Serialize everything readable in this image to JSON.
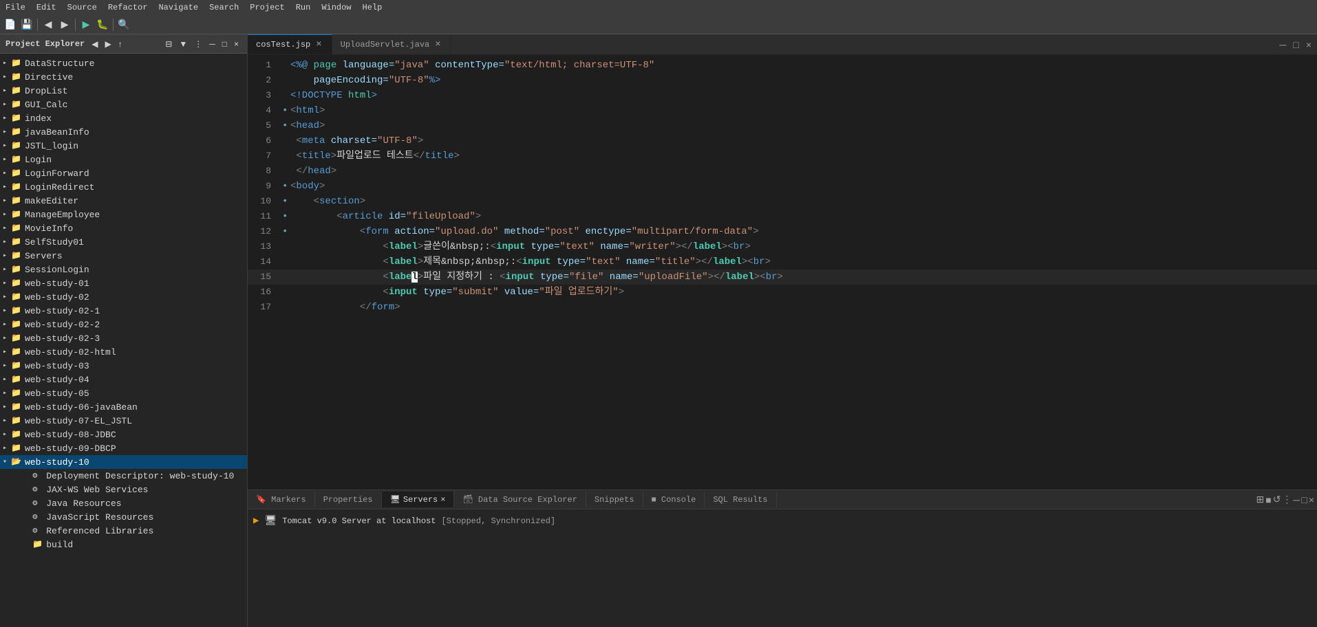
{
  "menu": {
    "items": [
      "File",
      "Edit",
      "Source",
      "Refactor",
      "Navigate",
      "Search",
      "Project",
      "Run",
      "Window",
      "Help"
    ]
  },
  "sidebar": {
    "title": "Project Explorer",
    "close_label": "×",
    "tree": [
      {
        "label": "DataStructure",
        "level": 0,
        "type": "folder",
        "expanded": false
      },
      {
        "label": "Directive",
        "level": 0,
        "type": "folder",
        "expanded": false
      },
      {
        "label": "DropList",
        "level": 0,
        "type": "folder",
        "expanded": false
      },
      {
        "label": "GUI_Calc",
        "level": 0,
        "type": "folder",
        "expanded": false
      },
      {
        "label": "index",
        "level": 0,
        "type": "folder",
        "expanded": false
      },
      {
        "label": "javaBeanInfo",
        "level": 0,
        "type": "folder",
        "expanded": false
      },
      {
        "label": "JSTL_login",
        "level": 0,
        "type": "folder",
        "expanded": false
      },
      {
        "label": "Login",
        "level": 0,
        "type": "folder",
        "expanded": false
      },
      {
        "label": "LoginForward",
        "level": 0,
        "type": "folder",
        "expanded": false
      },
      {
        "label": "LoginRedirect",
        "level": 0,
        "type": "folder",
        "expanded": false
      },
      {
        "label": "makeEditer",
        "level": 0,
        "type": "folder",
        "expanded": false
      },
      {
        "label": "ManageEmployee",
        "level": 0,
        "type": "folder",
        "expanded": false
      },
      {
        "label": "MovieInfo",
        "level": 0,
        "type": "folder",
        "expanded": false
      },
      {
        "label": "SelfStudy01",
        "level": 0,
        "type": "folder",
        "expanded": false
      },
      {
        "label": "Servers",
        "level": 0,
        "type": "folder",
        "expanded": false
      },
      {
        "label": "SessionLogin",
        "level": 0,
        "type": "folder",
        "expanded": false
      },
      {
        "label": "web-study-01",
        "level": 0,
        "type": "folder",
        "expanded": false
      },
      {
        "label": "web-study-02",
        "level": 0,
        "type": "folder",
        "expanded": false
      },
      {
        "label": "web-study-02-1",
        "level": 0,
        "type": "folder",
        "expanded": false
      },
      {
        "label": "web-study-02-2",
        "level": 0,
        "type": "folder",
        "expanded": false
      },
      {
        "label": "web-study-02-3",
        "level": 0,
        "type": "folder",
        "expanded": false
      },
      {
        "label": "web-study-02-html",
        "level": 0,
        "type": "folder",
        "expanded": false
      },
      {
        "label": "web-study-03",
        "level": 0,
        "type": "folder",
        "expanded": false
      },
      {
        "label": "web-study-04",
        "level": 0,
        "type": "folder",
        "expanded": false
      },
      {
        "label": "web-study-05",
        "level": 0,
        "type": "folder",
        "expanded": false
      },
      {
        "label": "web-study-06-javaBean",
        "level": 0,
        "type": "folder",
        "expanded": false
      },
      {
        "label": "web-study-07-EL_JSTL",
        "level": 0,
        "type": "folder",
        "expanded": false
      },
      {
        "label": "web-study-08-JDBC",
        "level": 0,
        "type": "folder",
        "expanded": false
      },
      {
        "label": "web-study-09-DBCP",
        "level": 0,
        "type": "folder",
        "expanded": false
      },
      {
        "label": "web-study-10",
        "level": 0,
        "type": "folder",
        "expanded": true,
        "selected": true
      },
      {
        "label": "Deployment Descriptor: web-study-10",
        "level": 1,
        "type": "config"
      },
      {
        "label": "JAX-WS Web Services",
        "level": 1,
        "type": "config"
      },
      {
        "label": "Java Resources",
        "level": 1,
        "type": "config"
      },
      {
        "label": "JavaScript Resources",
        "level": 1,
        "type": "config"
      },
      {
        "label": "Referenced Libraries",
        "level": 1,
        "type": "config"
      },
      {
        "label": "build",
        "level": 1,
        "type": "folder"
      }
    ]
  },
  "tabs": [
    {
      "label": "cosTest.jsp",
      "active": true,
      "modified": false
    },
    {
      "label": "UploadServlet.java",
      "active": false,
      "modified": false
    }
  ],
  "code": {
    "lines": [
      {
        "num": 1,
        "dot": false,
        "content_parts": [
          {
            "text": "<%@ ",
            "class": "kw-jsp"
          },
          {
            "text": "page ",
            "class": "kw-tag"
          },
          {
            "text": "language=",
            "class": "kw-attr"
          },
          {
            "text": "\"java\"",
            "class": "kw-str"
          },
          {
            "text": " contentType=",
            "class": "kw-attr"
          },
          {
            "text": "\"text/html; charset=UTF-8\"",
            "class": "kw-str"
          }
        ]
      },
      {
        "num": 2,
        "dot": false,
        "content_parts": [
          {
            "text": "    pageEncoding=",
            "class": "kw-attr"
          },
          {
            "text": "\"UTF-8\"",
            "class": "kw-str"
          },
          {
            "text": "%>",
            "class": "kw-jsp"
          }
        ]
      },
      {
        "num": 3,
        "dot": false,
        "content_parts": [
          {
            "text": "<!DOCTYPE ",
            "class": "kw-meta"
          },
          {
            "text": "html",
            "class": "kw-tag"
          },
          {
            "text": ">",
            "class": "kw-meta"
          }
        ]
      },
      {
        "num": 4,
        "dot": true,
        "content_parts": [
          {
            "text": "<",
            "class": "kw-tag-bracket"
          },
          {
            "text": "html",
            "class": "kw-html-tag"
          },
          {
            "text": ">",
            "class": "kw-tag-bracket"
          }
        ]
      },
      {
        "num": 5,
        "dot": true,
        "content_parts": [
          {
            "text": "<",
            "class": "kw-tag-bracket"
          },
          {
            "text": "head",
            "class": "kw-html-tag"
          },
          {
            "text": ">",
            "class": "kw-tag-bracket"
          }
        ]
      },
      {
        "num": 6,
        "dot": false,
        "content_parts": [
          {
            "text": " <",
            "class": "kw-tag-bracket"
          },
          {
            "text": "meta",
            "class": "kw-html-tag"
          },
          {
            "text": " charset=",
            "class": "kw-attr"
          },
          {
            "text": "\"UTF-8\"",
            "class": "kw-str"
          },
          {
            "text": ">",
            "class": "kw-tag-bracket"
          }
        ]
      },
      {
        "num": 7,
        "dot": false,
        "content_parts": [
          {
            "text": " <",
            "class": "kw-tag-bracket"
          },
          {
            "text": "title",
            "class": "kw-html-tag"
          },
          {
            "text": ">",
            "class": "kw-tag-bracket"
          },
          {
            "text": "파일업로드 테스트",
            "class": "kw-text"
          },
          {
            "text": "</",
            "class": "kw-tag-bracket"
          },
          {
            "text": "title",
            "class": "kw-html-tag"
          },
          {
            "text": ">",
            "class": "kw-tag-bracket"
          }
        ]
      },
      {
        "num": 8,
        "dot": false,
        "content_parts": [
          {
            "text": " </",
            "class": "kw-tag-bracket"
          },
          {
            "text": "head",
            "class": "kw-html-tag"
          },
          {
            "text": ">",
            "class": "kw-tag-bracket"
          }
        ]
      },
      {
        "num": 9,
        "dot": true,
        "content_parts": [
          {
            "text": "<",
            "class": "kw-tag-bracket"
          },
          {
            "text": "body",
            "class": "kw-html-tag"
          },
          {
            "text": ">",
            "class": "kw-tag-bracket"
          }
        ]
      },
      {
        "num": 10,
        "dot": true,
        "content_parts": [
          {
            "text": "    <",
            "class": "kw-tag-bracket"
          },
          {
            "text": "section",
            "class": "kw-html-tag"
          },
          {
            "text": ">",
            "class": "kw-tag-bracket"
          }
        ]
      },
      {
        "num": 11,
        "dot": true,
        "content_parts": [
          {
            "text": "        <",
            "class": "kw-tag-bracket"
          },
          {
            "text": "article",
            "class": "kw-html-tag"
          },
          {
            "text": " id=",
            "class": "kw-attr"
          },
          {
            "text": "\"fileUpload\"",
            "class": "kw-str"
          },
          {
            "text": ">",
            "class": "kw-tag-bracket"
          }
        ]
      },
      {
        "num": 12,
        "dot": true,
        "content_parts": [
          {
            "text": "            <",
            "class": "kw-tag-bracket"
          },
          {
            "text": "form",
            "class": "kw-html-tag"
          },
          {
            "text": " action=",
            "class": "kw-attr"
          },
          {
            "text": "\"upload.do\"",
            "class": "kw-str"
          },
          {
            "text": " method=",
            "class": "kw-attr"
          },
          {
            "text": "\"post\"",
            "class": "kw-str"
          },
          {
            "text": " enctype=",
            "class": "kw-attr"
          },
          {
            "text": "\"multipart/form-data\"",
            "class": "kw-str"
          },
          {
            "text": ">",
            "class": "kw-tag-bracket"
          }
        ]
      },
      {
        "num": 13,
        "dot": false,
        "content_parts": [
          {
            "text": "                <",
            "class": "kw-tag-bracket"
          },
          {
            "text": "label",
            "class": "kw-label"
          },
          {
            "text": ">",
            "class": "kw-tag-bracket"
          },
          {
            "text": "글쓴이&nbsp;:",
            "class": "kw-text"
          },
          {
            "text": "<",
            "class": "kw-tag-bracket"
          },
          {
            "text": "input",
            "class": "kw-input-tag"
          },
          {
            "text": " type=",
            "class": "kw-attr"
          },
          {
            "text": "\"text\"",
            "class": "kw-str"
          },
          {
            "text": " name=",
            "class": "kw-attr"
          },
          {
            "text": "\"writer\"",
            "class": "kw-str"
          },
          {
            "text": ">",
            "class": "kw-tag-bracket"
          },
          {
            "text": "</",
            "class": "kw-tag-bracket"
          },
          {
            "text": "label",
            "class": "kw-label"
          },
          {
            "text": "><",
            "class": "kw-tag-bracket"
          },
          {
            "text": "br",
            "class": "kw-html-tag"
          },
          {
            "text": ">",
            "class": "kw-tag-bracket"
          }
        ]
      },
      {
        "num": 14,
        "dot": false,
        "content_parts": [
          {
            "text": "                <",
            "class": "kw-tag-bracket"
          },
          {
            "text": "label",
            "class": "kw-label"
          },
          {
            "text": ">",
            "class": "kw-tag-bracket"
          },
          {
            "text": "제목&nbsp;&nbsp;:",
            "class": "kw-text"
          },
          {
            "text": "<",
            "class": "kw-tag-bracket"
          },
          {
            "text": "input",
            "class": "kw-input-tag"
          },
          {
            "text": " type=",
            "class": "kw-attr"
          },
          {
            "text": "\"text\"",
            "class": "kw-str"
          },
          {
            "text": " name=",
            "class": "kw-attr"
          },
          {
            "text": "\"title\"",
            "class": "kw-str"
          },
          {
            "text": ">",
            "class": "kw-tag-bracket"
          },
          {
            "text": "</",
            "class": "kw-tag-bracket"
          },
          {
            "text": "label",
            "class": "kw-label"
          },
          {
            "text": "><",
            "class": "kw-tag-bracket"
          },
          {
            "text": "br",
            "class": "kw-html-tag"
          },
          {
            "text": ">",
            "class": "kw-tag-bracket"
          }
        ]
      },
      {
        "num": 15,
        "dot": false,
        "cursor": true,
        "content_parts": [
          {
            "text": "                <",
            "class": "kw-tag-bracket"
          },
          {
            "text": "label",
            "class": "kw-label"
          },
          {
            "text": ">",
            "class": "kw-tag-bracket"
          },
          {
            "text": "파일 지정하기 : ",
            "class": "kw-text"
          },
          {
            "text": "<",
            "class": "kw-tag-bracket"
          },
          {
            "text": "input",
            "class": "kw-input-tag"
          },
          {
            "text": " type=",
            "class": "kw-attr"
          },
          {
            "text": "\"file\"",
            "class": "kw-str"
          },
          {
            "text": " name=",
            "class": "kw-attr"
          },
          {
            "text": "\"uploadFile\"",
            "class": "kw-str"
          },
          {
            "text": ">",
            "class": "kw-tag-bracket"
          },
          {
            "text": "</",
            "class": "kw-tag-bracket"
          },
          {
            "text": "label",
            "class": "kw-label"
          },
          {
            "text": "><",
            "class": "kw-tag-bracket"
          },
          {
            "text": "br",
            "class": "kw-html-tag"
          },
          {
            "text": ">",
            "class": "kw-tag-bracket"
          }
        ]
      },
      {
        "num": 16,
        "dot": false,
        "content_parts": [
          {
            "text": "                <",
            "class": "kw-tag-bracket"
          },
          {
            "text": "input",
            "class": "kw-input-tag"
          },
          {
            "text": " type=",
            "class": "kw-attr"
          },
          {
            "text": "\"submit\"",
            "class": "kw-str"
          },
          {
            "text": " value=",
            "class": "kw-attr"
          },
          {
            "text": "\"파일 업로드하기\"",
            "class": "kw-str"
          },
          {
            "text": ">",
            "class": "kw-tag-bracket"
          }
        ]
      },
      {
        "num": 17,
        "dot": false,
        "content_parts": [
          {
            "text": "            </",
            "class": "kw-tag-bracket"
          },
          {
            "text": "form",
            "class": "kw-html-tag"
          },
          {
            "text": ">",
            "class": "kw-tag-bracket"
          }
        ]
      }
    ]
  },
  "bottom_panel": {
    "tabs": [
      {
        "label": "Markers",
        "active": false
      },
      {
        "label": "Properties",
        "active": false
      },
      {
        "label": "Servers",
        "active": true,
        "closeable": true
      },
      {
        "label": "Data Source Explorer",
        "active": false
      },
      {
        "label": "Snippets",
        "active": false
      },
      {
        "label": "Console",
        "active": false
      },
      {
        "label": "SQL Results",
        "active": false
      }
    ],
    "server_item": {
      "icon": "▶",
      "label": "Tomcat v9.0 Server at localhost",
      "status": "[Stopped, Synchronized]"
    }
  }
}
